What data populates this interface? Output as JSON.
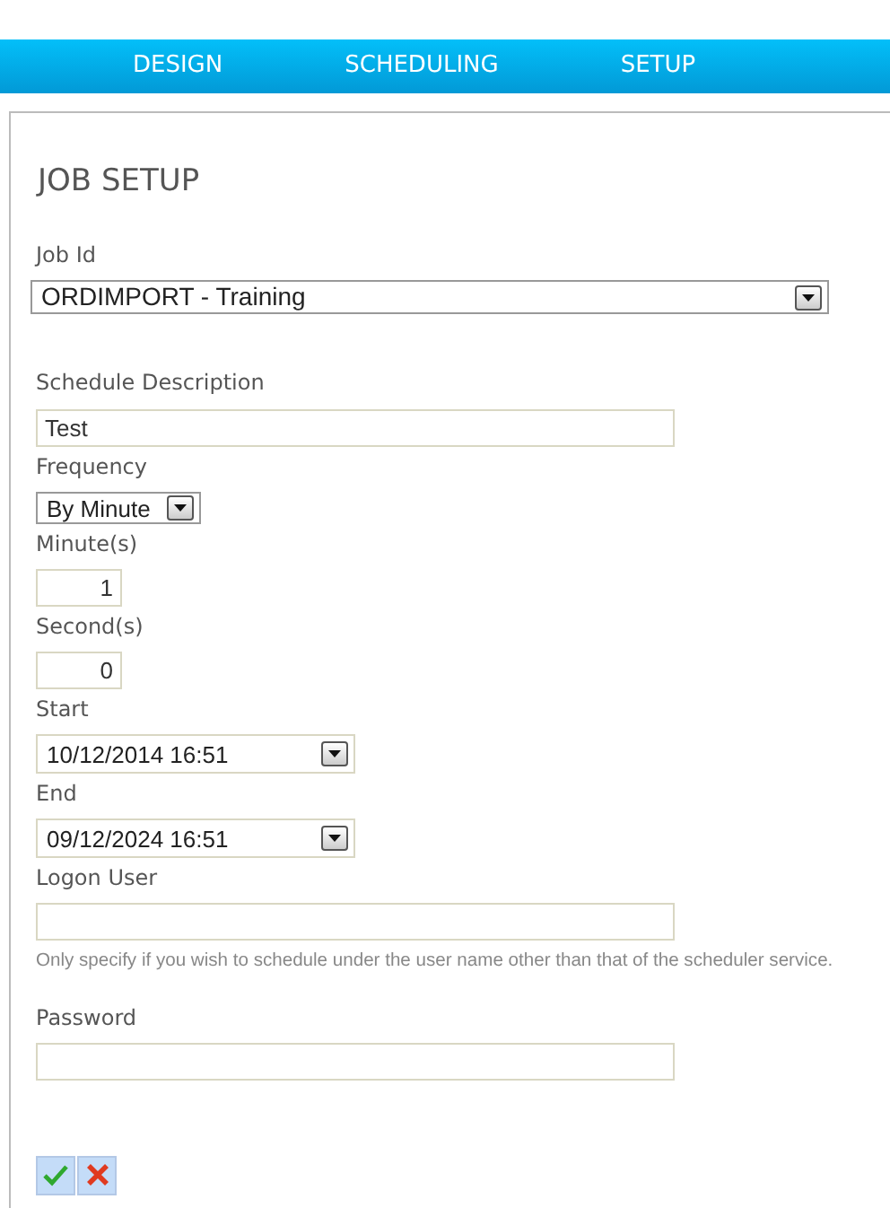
{
  "nav": [
    {
      "label": "DESIGN"
    },
    {
      "label": "SCHEDULING"
    },
    {
      "label": "SETUP"
    }
  ],
  "title": "JOB SETUP",
  "fields": [
    {
      "label": "Job Id",
      "kind": "select",
      "value": "ORDIMPORT - Training"
    },
    {
      "label": "Schedule Description",
      "kind": "text",
      "value": "Test"
    },
    {
      "label": "Frequency",
      "kind": "small-select",
      "value": "By Minute"
    },
    {
      "label": "Minute(s)",
      "kind": "number",
      "value": "1"
    },
    {
      "label": "Second(s)",
      "kind": "number",
      "value": "0"
    },
    {
      "label": "Start",
      "kind": "datetime",
      "value": "10/12/2014 16:51"
    },
    {
      "label": "End",
      "kind": "datetime",
      "value": "09/12/2024 16:51"
    },
    {
      "label": "Logon User",
      "kind": "text",
      "hint": "Only specify if you wish to schedule under the user name other than that of the scheduler service."
    },
    {
      "label": "Password",
      "kind": "password"
    }
  ],
  "actions": [
    {
      "kind": "save"
    },
    {
      "kind": "cancel"
    }
  ]
}
